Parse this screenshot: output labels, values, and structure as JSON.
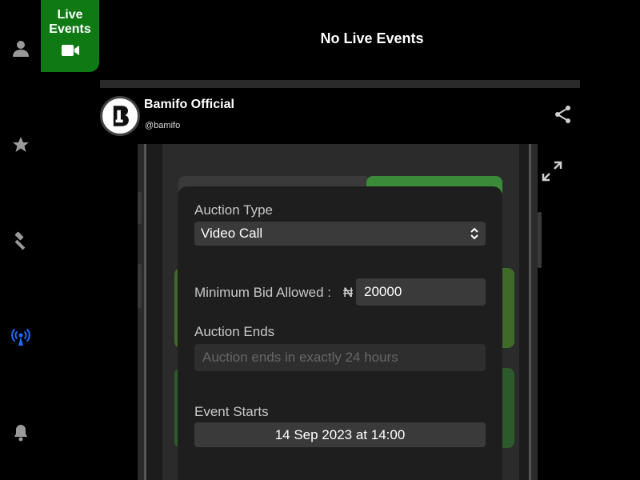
{
  "sidebar": {
    "items": [
      {
        "name": "profile",
        "icon": "user-icon"
      },
      {
        "name": "favorites",
        "icon": "star-icon"
      },
      {
        "name": "auctions",
        "icon": "gavel-icon"
      },
      {
        "name": "live",
        "icon": "broadcast-icon",
        "active": true
      },
      {
        "name": "notifications",
        "icon": "bell-icon"
      }
    ],
    "active_color": "#1e6bff"
  },
  "live_tab": {
    "label": "Live Events",
    "icon": "video-camera-icon",
    "color": "#0f7a13"
  },
  "header": {
    "title": "No Live Events"
  },
  "account": {
    "name": "Bamifo Official",
    "handle": "@bamifo"
  },
  "actions": {
    "share_icon": "share-icon",
    "expand_icon": "expand-icon"
  },
  "auction_form": {
    "auction_type_label": "Auction Type",
    "auction_type_value": "Video Call",
    "min_bid_label": "Minimum Bid Allowed :",
    "currency_symbol": "₦",
    "min_bid_value": "20000",
    "auction_ends_label": "Auction Ends",
    "auction_ends_placeholder": "Auction ends in exactly 24 hours",
    "event_starts_label": "Event Starts",
    "event_starts_value": "14 Sep 2023 at 14:00"
  }
}
